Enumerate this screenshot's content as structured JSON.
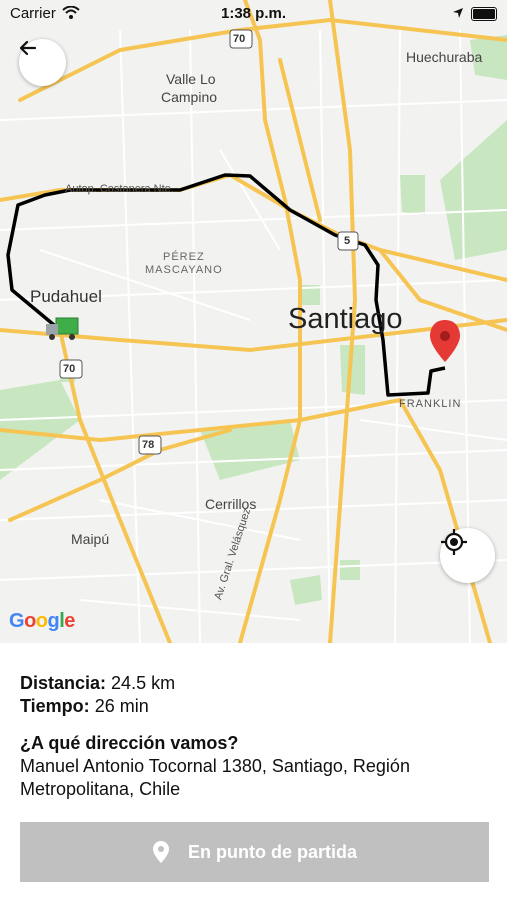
{
  "status_bar": {
    "carrier": "Carrier",
    "time": "1:38 p.m."
  },
  "map": {
    "labels": {
      "huechuraba": "Huechuraba",
      "valle_lo_campino_1": "Valle Lo",
      "valle_lo_campino_2": "Campino",
      "costanera": "Autop. Costanera Nte.",
      "perez_1": "PÉREZ",
      "perez_2": "MASCAYANO",
      "pudahuel": "Pudahuel",
      "santiago": "Santiago",
      "franklin": "FRANKLIN",
      "cerrillos": "Cerrillos",
      "maipu": "Maipú",
      "gral_velasquez": "Av. Gral. Velásquez",
      "shield_70_top": "70",
      "shield_70_left": "70",
      "shield_5": "5",
      "shield_78": "78"
    },
    "google_logo": {
      "g1": "G",
      "o1": "o",
      "o2": "o",
      "g2": "g",
      "l": "l",
      "e": "e"
    },
    "colors": {
      "route": "#000000",
      "destination_pin": "#e53935",
      "highway": "#f6c452"
    }
  },
  "trip": {
    "distance_label": "Distancia:",
    "distance_value": "24.5 km",
    "time_label": "Tiempo:",
    "time_value": "26 min",
    "question": "¿A qué dirección vamos?",
    "address": "Manuel Antonio Tocornal 1380, Santiago, Región Metropolitana, Chile"
  },
  "action_button": {
    "label": "En punto de partida",
    "icon": "location-pin-icon"
  }
}
